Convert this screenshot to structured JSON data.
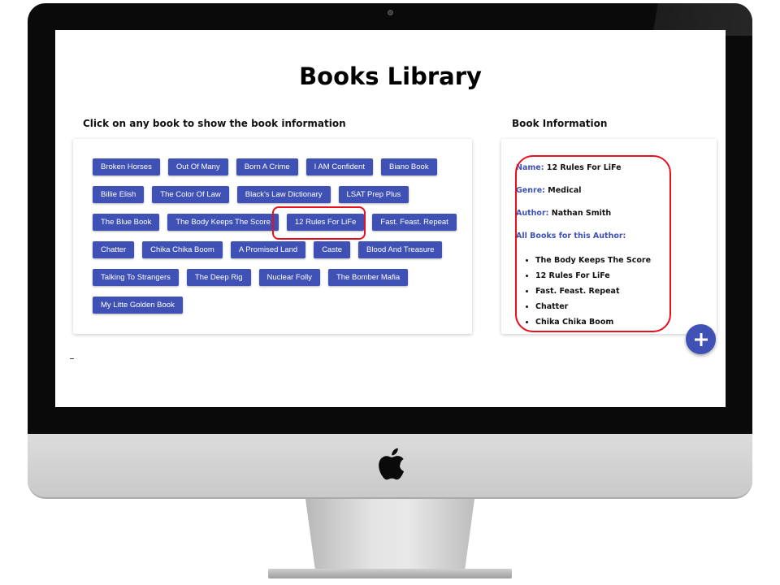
{
  "page": {
    "title": "Books Library",
    "books_heading": "Click on any book to show the book information",
    "info_heading": "Book Information"
  },
  "books": [
    "Broken Horses",
    "Out Of Many",
    "Born A Crime",
    "I AM Confident",
    "Biano Book",
    "Billie Elish",
    "The Color Of Law",
    "Black's Law Dictionary",
    "LSAT Prep Plus",
    "The Blue Book",
    "The Body Keeps The Score",
    "12 Rules For LiFe",
    "Fast. Feast. Repeat",
    "Chatter",
    "Chika Chika Boom",
    "A Promised Land",
    "Caste",
    "Blood And Treasure",
    "Talking To Strangers",
    "The Deep Rig",
    "Nuclear Folly",
    "The Bomber Mafia",
    "My Litte Golden Book"
  ],
  "selected_book": "12 Rules For LiFe",
  "info": {
    "name_label": "Name:",
    "name": "12 Rules For LiFe",
    "genre_label": "Genre:",
    "genre": "Medical",
    "author_label": "Author:",
    "author": "Nathan Smith",
    "all_books_label": "All Books for this Author:",
    "author_books": [
      "The Body Keeps The Score",
      "12 Rules For LiFe",
      "Fast. Feast. Repeat",
      "Chatter",
      "Chika Chika Boom"
    ]
  },
  "fab": {
    "icon": "plus-icon"
  },
  "colors": {
    "primary": "#3f51b5",
    "highlight": "#e8101e",
    "text": "#111111"
  }
}
